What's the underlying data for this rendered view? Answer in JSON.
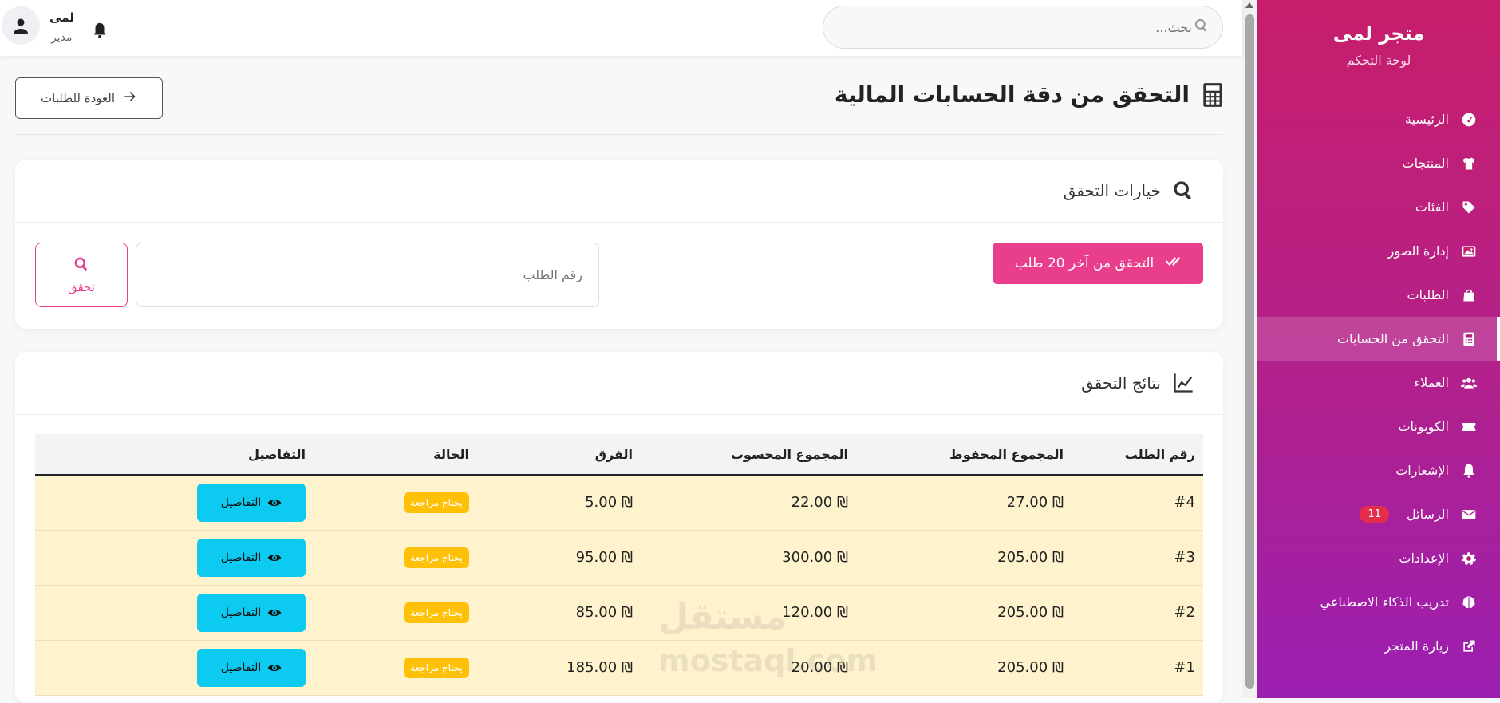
{
  "sidebar": {
    "brand_title": "متجر لمى",
    "brand_subtitle": "لوحة التحكم",
    "items": [
      {
        "label": "الرئيسية",
        "icon": "dashboard-icon"
      },
      {
        "label": "المنتجات",
        "icon": "shirt-icon"
      },
      {
        "label": "الفئات",
        "icon": "tags-icon"
      },
      {
        "label": "إدارة الصور",
        "icon": "images-icon"
      },
      {
        "label": "الطلبات",
        "icon": "bag-icon"
      },
      {
        "label": "التحقق من الحسابات",
        "icon": "calculator-icon",
        "active": true
      },
      {
        "label": "العملاء",
        "icon": "users-icon"
      },
      {
        "label": "الكوبونات",
        "icon": "ticket-icon"
      },
      {
        "label": "الإشعارات",
        "icon": "bell-icon"
      },
      {
        "label": "الرسائل",
        "icon": "envelope-icon",
        "badge": "11"
      },
      {
        "label": "الإعدادات",
        "icon": "gear-icon"
      },
      {
        "label": "تدريب الذكاء الاصطناعي",
        "icon": "brain-icon"
      },
      {
        "label": "زيارة المتجر",
        "icon": "external-link-icon"
      }
    ]
  },
  "topbar": {
    "search_placeholder": "بحث...",
    "user_name": "لمى",
    "user_role": "مدير"
  },
  "page": {
    "title": "التحقق من دقة الحسابات المالية",
    "back_label": "العودة للطلبات"
  },
  "options_card": {
    "title": "خيارات التحقق",
    "verify_last_label": "التحقق من آخر 20 طلب",
    "order_input_placeholder": "رقم الطلب",
    "verify_button_label": "تحقق"
  },
  "results_card": {
    "title": "نتائج التحقق",
    "columns": [
      "رقم الطلب",
      "المجموع المحفوظ",
      "المجموع المحسوب",
      "الفرق",
      "الحالة",
      "التفاصيل"
    ],
    "rows": [
      {
        "order": "#4",
        "saved": "₪ 27.00",
        "calculated": "₪ 22.00",
        "difference": "₪ 5.00",
        "status": "يحتاج مراجعة",
        "details": "التفاصيل"
      },
      {
        "order": "#3",
        "saved": "₪ 205.00",
        "calculated": "₪ 300.00",
        "difference": "₪ 95.00",
        "status": "يحتاج مراجعة",
        "details": "التفاصيل"
      },
      {
        "order": "#2",
        "saved": "₪ 205.00",
        "calculated": "₪ 120.00",
        "difference": "₪ 85.00",
        "status": "يحتاج مراجعة",
        "details": "التفاصيل"
      },
      {
        "order": "#1",
        "saved": "₪ 205.00",
        "calculated": "₪ 20.00",
        "difference": "₪ 185.00",
        "status": "يحتاج مراجعة",
        "details": "التفاصيل"
      }
    ]
  },
  "watermark": {
    "ar": "مستقل",
    "en": "mostaql.com"
  },
  "colors": {
    "primary": "#e83e8c",
    "sidebar_top": "#c81e6b",
    "sidebar_bottom": "#9b1fb1",
    "warning_row": "#fff3cd",
    "status_badge": "#ffc107",
    "details_button": "#0dcaf0",
    "difference_text": "#dc3545"
  }
}
